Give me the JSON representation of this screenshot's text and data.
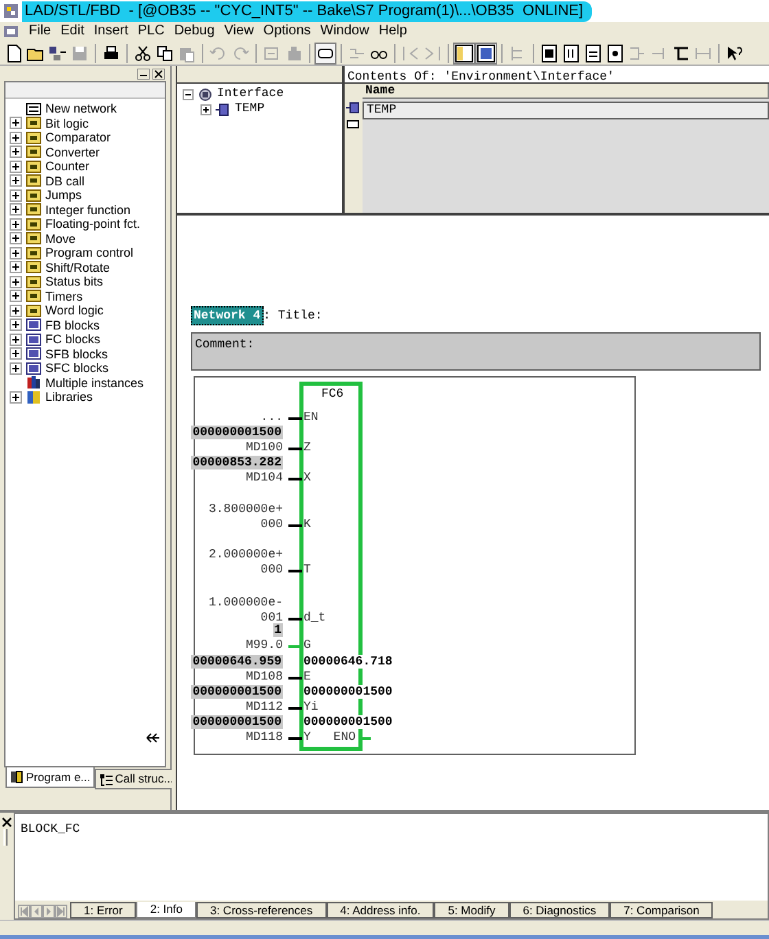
{
  "window": {
    "title": "LAD/STL/FBD  - [@OB35 -- \"CYC_INT5\" -- Bake\\S7 Program(1)\\...\\OB35  ONLINE]"
  },
  "menu": [
    "File",
    "Edit",
    "Insert",
    "PLC",
    "Debug",
    "View",
    "Options",
    "Window",
    "Help"
  ],
  "toolbar": [
    [
      {
        "disabled": false,
        "pressed": false
      },
      {
        "disabled": false,
        "pressed": false
      },
      {
        "disabled": false,
        "pressed": false
      },
      {
        "disabled": true,
        "pressed": false
      }
    ],
    [
      {
        "disabled": false,
        "pressed": false
      }
    ],
    [
      {
        "disabled": false,
        "pressed": false
      },
      {
        "disabled": false,
        "pressed": false
      },
      {
        "disabled": true,
        "pressed": false
      }
    ],
    [
      {
        "disabled": true,
        "pressed": false
      },
      {
        "disabled": true,
        "pressed": false
      }
    ],
    [
      {
        "disabled": true,
        "pressed": false
      },
      {
        "disabled": true,
        "pressed": false
      }
    ],
    [
      {
        "disabled": false,
        "pressed": true
      }
    ],
    [
      {
        "disabled": true,
        "pressed": false
      },
      {
        "disabled": false,
        "pressed": false
      }
    ],
    [
      {
        "disabled": true,
        "pressed": false
      },
      {
        "disabled": true,
        "pressed": false
      }
    ],
    [
      {
        "disabled": false,
        "pressed": true
      },
      {
        "disabled": false,
        "pressed": true
      }
    ],
    [
      {
        "disabled": true,
        "pressed": false
      }
    ],
    [
      {
        "disabled": false,
        "pressed": false
      },
      {
        "disabled": false,
        "pressed": false
      },
      {
        "disabled": false,
        "pressed": false
      },
      {
        "disabled": false,
        "pressed": false
      },
      {
        "disabled": true,
        "pressed": false
      },
      {
        "disabled": true,
        "pressed": false
      },
      {
        "disabled": false,
        "pressed": false
      },
      {
        "disabled": true,
        "pressed": false
      }
    ],
    [
      {
        "disabled": false,
        "pressed": false
      }
    ]
  ],
  "catalog": {
    "items": [
      {
        "label": "New network",
        "kind": "network",
        "expandable": false
      },
      {
        "label": "Bit logic",
        "kind": "folder",
        "expandable": true
      },
      {
        "label": "Comparator",
        "kind": "folder",
        "expandable": true
      },
      {
        "label": "Converter",
        "kind": "folder",
        "expandable": true
      },
      {
        "label": "Counter",
        "kind": "folder",
        "expandable": true
      },
      {
        "label": "DB call",
        "kind": "folder",
        "expandable": true
      },
      {
        "label": "Jumps",
        "kind": "folder",
        "expandable": true
      },
      {
        "label": "Integer function",
        "kind": "folder",
        "expandable": true
      },
      {
        "label": "Floating-point fct.",
        "kind": "folder",
        "expandable": true
      },
      {
        "label": "Move",
        "kind": "folder",
        "expandable": true
      },
      {
        "label": "Program control",
        "kind": "folder",
        "expandable": true
      },
      {
        "label": "Shift/Rotate",
        "kind": "folder",
        "expandable": true
      },
      {
        "label": "Status bits",
        "kind": "folder",
        "expandable": true
      },
      {
        "label": "Timers",
        "kind": "folder",
        "expandable": true
      },
      {
        "label": "Word logic",
        "kind": "folder",
        "expandable": true
      },
      {
        "label": "FB blocks",
        "kind": "block",
        "expandable": true
      },
      {
        "label": "FC blocks",
        "kind": "block",
        "expandable": true
      },
      {
        "label": "SFB blocks",
        "kind": "block",
        "expandable": true
      },
      {
        "label": "SFC blocks",
        "kind": "block",
        "expandable": true
      },
      {
        "label": "Multiple instances",
        "kind": "instances",
        "expandable": false
      },
      {
        "label": "Libraries",
        "kind": "library",
        "expandable": true
      }
    ],
    "tabs": [
      {
        "label": "Program e...",
        "selected": true
      },
      {
        "label": "Call struc...",
        "selected": false
      }
    ]
  },
  "interface_tree": [
    {
      "label": "Interface",
      "expanded": true,
      "children": [
        {
          "label": "TEMP",
          "expanded": false
        }
      ]
    }
  ],
  "contents": {
    "title": "Contents Of: 'Environment\\Interface'",
    "columns": [
      "Name"
    ],
    "rows": [
      {
        "name": "TEMP"
      }
    ]
  },
  "network": {
    "label": "Network 4",
    "title": ": Title:",
    "comment": "Comment:",
    "block": {
      "name": "FC6",
      "eno": "ENO",
      "eno_powered": true,
      "inputs": [
        {
          "pin": "EN",
          "lines": [
            "..."
          ],
          "powered": false
        },
        {
          "pin": "Z",
          "monitor": "000000001500",
          "lines": [
            "MD100"
          ],
          "powered": false
        },
        {
          "pin": "X",
          "monitor": "00000853.282",
          "lines": [
            "MD104"
          ],
          "powered": false
        },
        {
          "pin": "K",
          "lines": [
            "3.800000e+",
            "000"
          ],
          "powered": false
        },
        {
          "pin": "T",
          "lines": [
            "2.000000e+",
            "000"
          ],
          "powered": false
        },
        {
          "pin": "d_t",
          "lines": [
            "1.000000e-",
            "001"
          ],
          "powered": false
        },
        {
          "pin": "G",
          "monitor": "1",
          "lines": [
            "M99.0"
          ],
          "powered": true
        },
        {
          "pin": "E",
          "monitor": "00000646.959",
          "output": "00000646.718",
          "lines": [
            "MD108"
          ],
          "powered": false
        },
        {
          "pin": "Yi",
          "monitor": "000000001500",
          "output": "000000001500",
          "lines": [
            "MD112"
          ],
          "powered": false
        },
        {
          "pin": "Y",
          "monitor": "000000001500",
          "output": "000000001500",
          "lines": [
            "MD118"
          ],
          "powered": false
        }
      ]
    }
  },
  "output_pane": {
    "text": "BLOCK_FC",
    "tabs": [
      {
        "label": "1: Error",
        "selected": false
      },
      {
        "label": "2: Info",
        "selected": true
      },
      {
        "label": "3: Cross-references",
        "selected": false
      },
      {
        "label": "4: Address info.",
        "selected": false
      },
      {
        "label": "5: Modify",
        "selected": false
      },
      {
        "label": "6: Diagnostics",
        "selected": false
      },
      {
        "label": "7: Comparison",
        "selected": false
      }
    ]
  }
}
